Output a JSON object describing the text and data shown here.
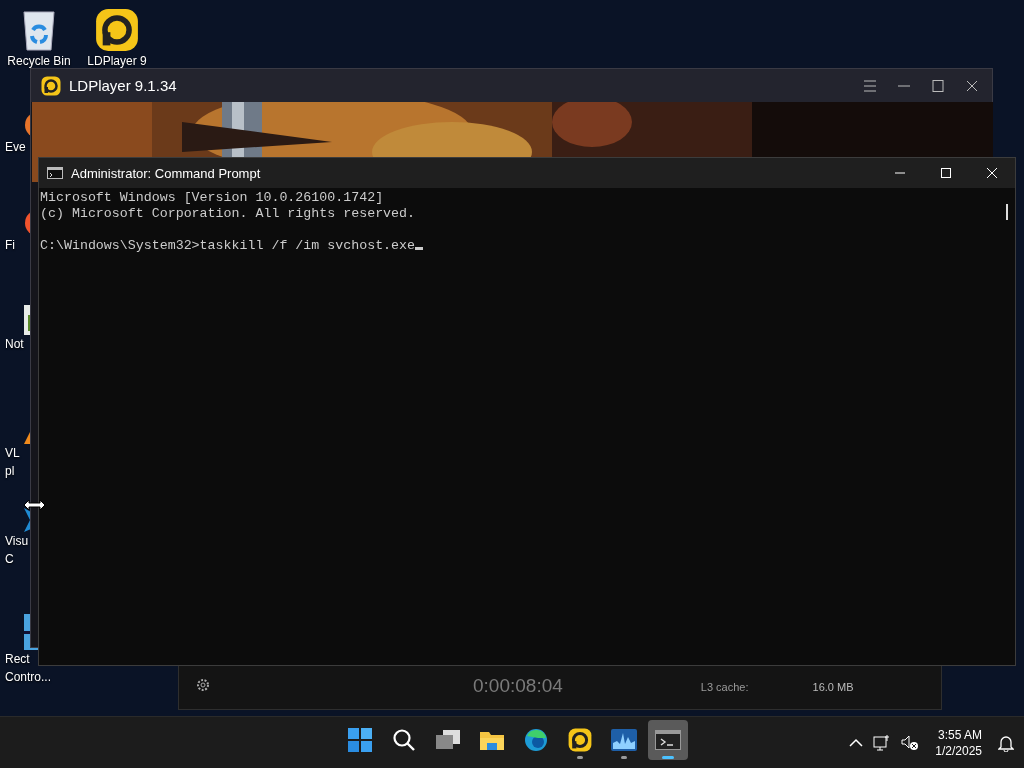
{
  "desktop_icons": [
    {
      "kind": "recycle-bin",
      "lines": [
        "Recycle Bin"
      ]
    },
    {
      "kind": "ldplayer",
      "lines": [
        "LDPlayer 9"
      ]
    },
    {
      "kind": "orange-app",
      "lines": [
        "Eve"
      ]
    },
    {
      "kind": "firefox",
      "lines": [
        "Fi"
      ]
    },
    {
      "kind": "notepad",
      "lines": [
        "Not"
      ]
    },
    {
      "kind": "vlc",
      "lines": [
        "VL",
        "pl"
      ]
    },
    {
      "kind": "vscode",
      "lines": [
        "Visu",
        "C"
      ]
    },
    {
      "kind": "rect",
      "lines": [
        "Rect",
        "Contro..."
      ]
    }
  ],
  "ldplayer_window": {
    "title": "LDPlayer 9.1.34"
  },
  "task_manager": {
    "elapsed": "0:00:08:04",
    "rows": [
      {
        "label": "L3 cache:",
        "value": "16.0 MB"
      }
    ]
  },
  "cmd_window": {
    "title": "Administrator: Command Prompt",
    "lines": [
      "Microsoft Windows [Version 10.0.26100.1742]",
      "(c) Microsoft Corporation. All rights reserved."
    ],
    "command_line": "C:\\Windows\\System32>taskkill /f /im svchost.exe",
    "cursor": true
  },
  "taskbar": {
    "apps": [
      {
        "kind": "start",
        "running": false,
        "selected": false
      },
      {
        "kind": "search",
        "running": false,
        "selected": false
      },
      {
        "kind": "task-view",
        "running": false,
        "selected": false
      },
      {
        "kind": "explorer",
        "running": false,
        "selected": false
      },
      {
        "kind": "edge",
        "running": false,
        "selected": false
      },
      {
        "kind": "ldplayer",
        "running": true,
        "selected": false
      },
      {
        "kind": "perfmon",
        "running": true,
        "selected": false
      },
      {
        "kind": "cmd",
        "running": true,
        "selected": true
      }
    ],
    "time": "3:55 AM",
    "date": "1/2/2025"
  }
}
